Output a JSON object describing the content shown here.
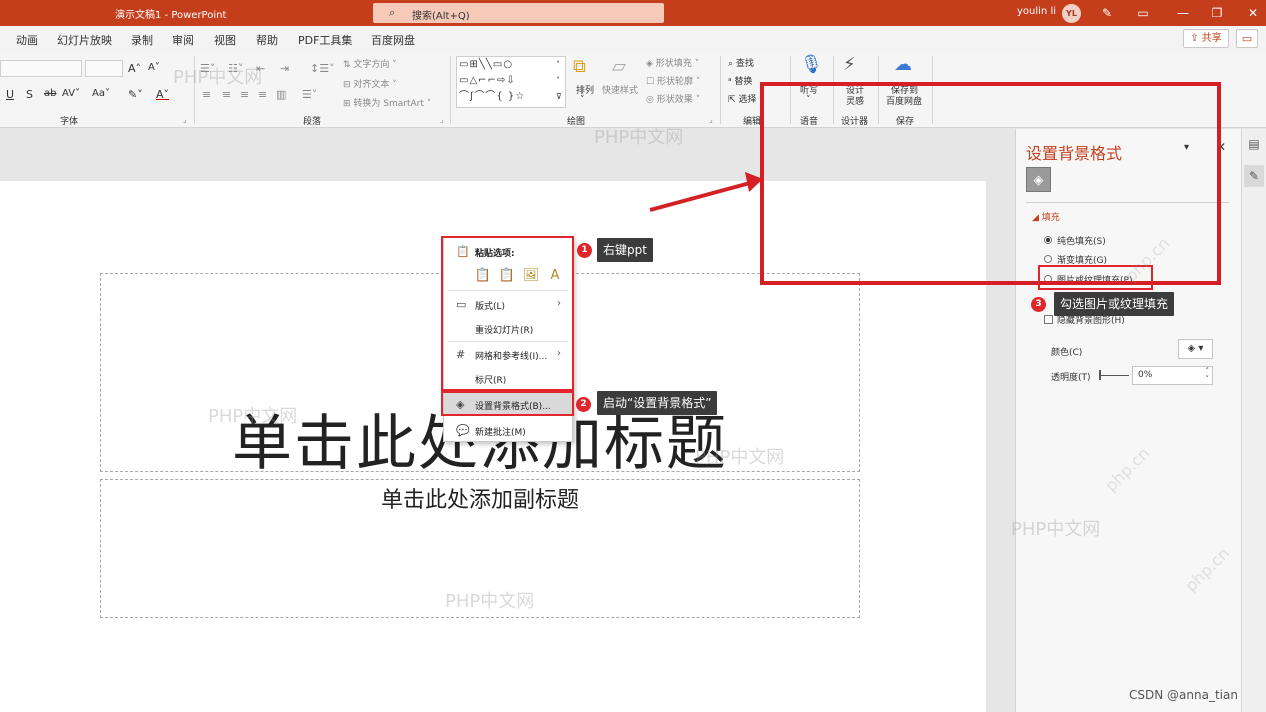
{
  "titlebar": {
    "doc_title": "演示文稿1  -  PowerPoint",
    "search_placeholder": "搜索(Alt+Q)",
    "user_name": "youlin li",
    "avatar_initials": "YL"
  },
  "menu": {
    "tabs": [
      "动画",
      "幻灯片放映",
      "录制",
      "审阅",
      "视图",
      "帮助",
      "PDF工具集",
      "百度网盘"
    ],
    "share_label": "共享"
  },
  "ribbon": {
    "font_group_label": "字体",
    "paragraph_group_label": "段落",
    "drawing_group_label": "绘图",
    "edit_group_label": "编辑",
    "voice_group_label": "语音",
    "designer_group_label": "设计器",
    "save_group_label": "保存",
    "text_direction": "文字方向",
    "align_text": "对齐文本",
    "convert_smartart": "转换为 SmartArt",
    "arrange": "排列",
    "quick_styles": "快速样式",
    "shape_fill": "形状填充",
    "shape_outline": "形状轮廓",
    "shape_effects": "形状效果",
    "find": "查找",
    "replace": "替换",
    "select": "选择",
    "dictate": "听写",
    "design_ideas_1": "设计",
    "design_ideas_2": "灵感",
    "save_baidu_1": "保存到",
    "save_baidu_2": "百度网盘"
  },
  "slide": {
    "title_placeholder": "单击此处添加标题",
    "subtitle_placeholder": "单击此处添加副标题"
  },
  "context_menu": {
    "paste_options": "粘贴选项:",
    "layout": "版式(L)",
    "reset_slide": "重设幻灯片(R)",
    "grid_guides": "网格和参考线(I)...",
    "ruler": "标尺(R)",
    "format_background": "设置背景格式(B)...",
    "new_comment": "新建批注(M)"
  },
  "panel": {
    "title": "设置背景格式",
    "fill_section": "填充",
    "solid_fill": "纯色填充(S)",
    "gradient_fill": "渐变填充(G)",
    "picture_texture_fill": "图片或纹理填充(P)",
    "hide_background": "隐藏背景图形(H)",
    "color_label": "颜色(C)",
    "transparency_label": "透明度(T)",
    "transparency_value": "0%"
  },
  "annotations": {
    "step1_num": "1",
    "step1_text": "右键ppt",
    "step2_num": "2",
    "step2_text": "启动“设置背景格式”",
    "step3_num": "3",
    "step3_text": "勾选图片或纹理填充",
    "accent_color": "#e0262a"
  },
  "watermarks": {
    "site": "PHP中文网",
    "site2": "php.cn",
    "credit": "CSDN @anna_tian"
  }
}
